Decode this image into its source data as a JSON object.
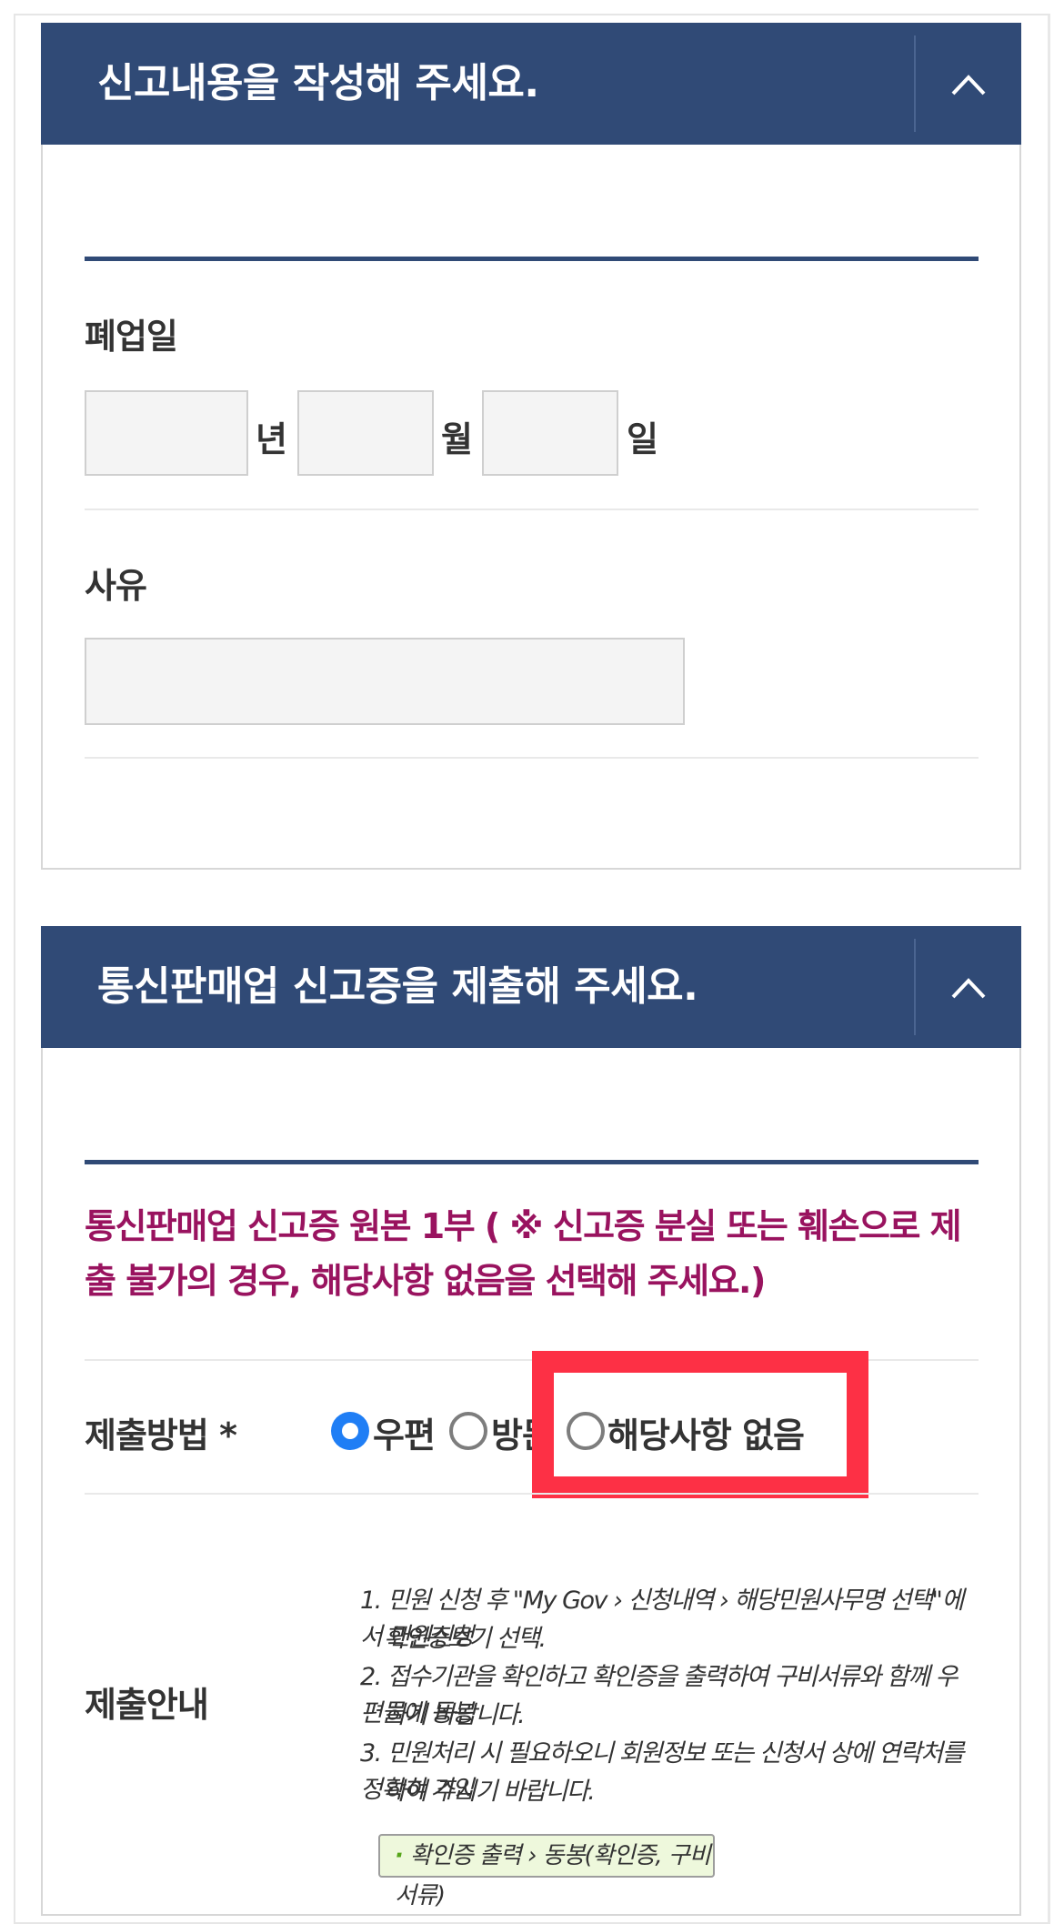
{
  "section1": {
    "title": "신고내용을 작성해 주세요.",
    "closure_date_label": "폐업일",
    "year_unit": "년",
    "month_unit": "월",
    "day_unit": "일",
    "reason_label": "사유"
  },
  "section2": {
    "title": "통신판매업 신고증을 제출해 주세요.",
    "notice_line1": "통신판매업 신고증 원본 1부 ( ※ 신고증 분실 또는 훼손으로 제",
    "notice_line2": "출 불가의 경우, 해당사항 없음을 선택해 주세요.)",
    "submit_method_label": "제출방법 *",
    "options": [
      {
        "label": "우편",
        "selected": true
      },
      {
        "label": "방문",
        "selected": false
      },
      {
        "label": "해당사항 없음",
        "selected": false
      }
    ],
    "guide_label": "제출안내",
    "guide_items": [
      "1. 민원 신청 후 \"My Gov › 신청내역 › 해당민원사무명 선택\"에서 민원신청",
      "확인증보기 선택.",
      "2. 접수기관을 확인하고 확인증을 출력하여 구비서류와 함께 우편물에 동봉",
      "하기 바랍니다.",
      "3. 민원처리 시 필요하오니 회원정보 또는 신청서 상에 연락처를 정확히 기입",
      "하여 주시기 바랍니다."
    ],
    "guide_pill": "확인증 출력 › 동봉(확인증, 구비서류)"
  },
  "colors": {
    "header_bg": "#304a76",
    "notice_text": "#99135f",
    "radio_selected": "#1f7ef5",
    "highlight": "#fd3045"
  }
}
